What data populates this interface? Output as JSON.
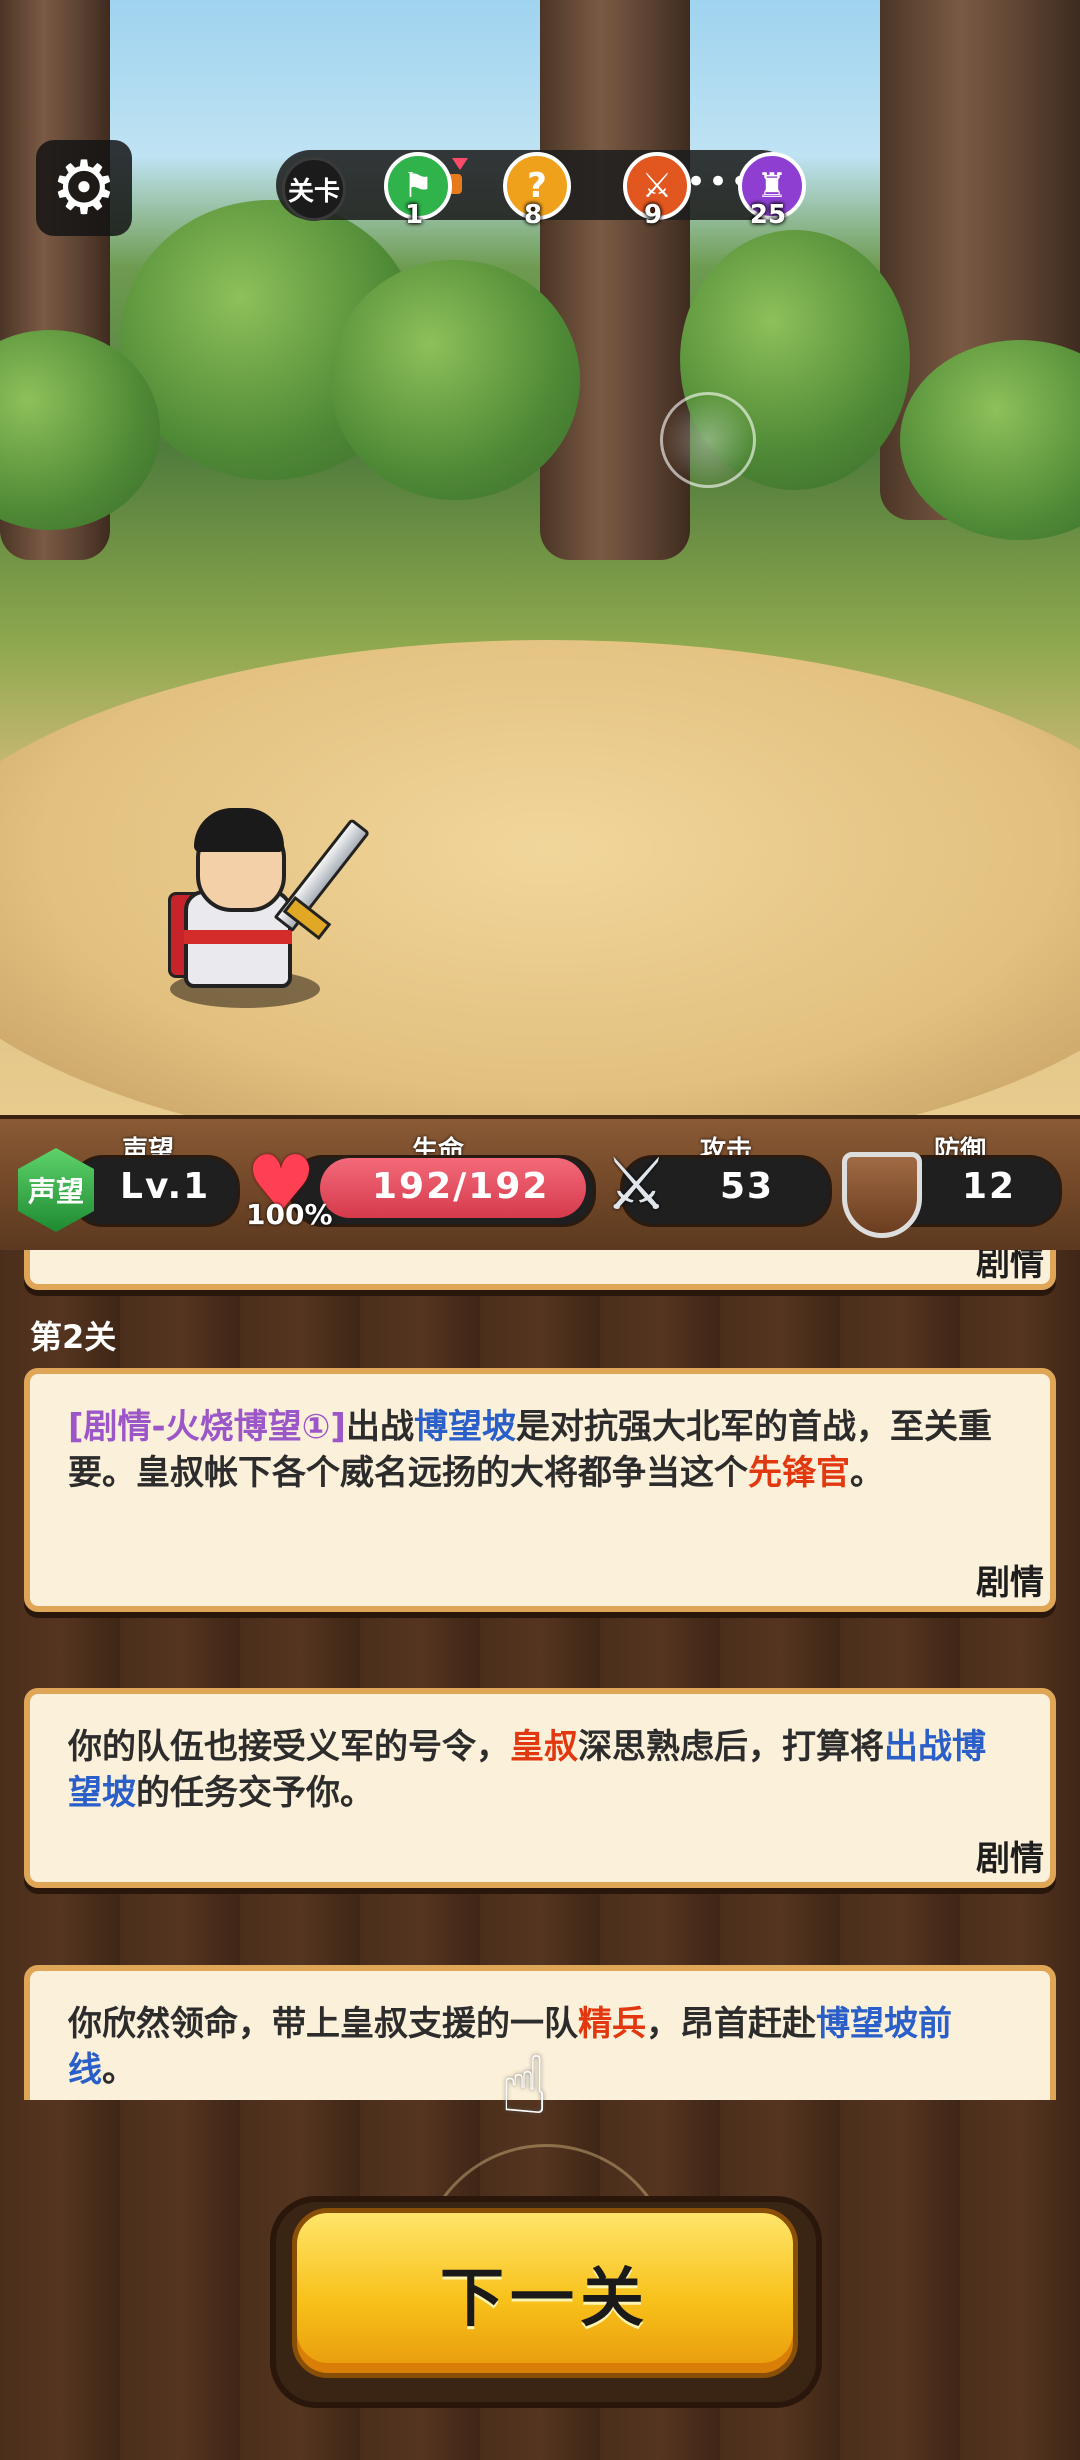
{
  "hud": {
    "settings_icon": "gear-icon",
    "level_label": "关卡",
    "level_nodes": [
      {
        "number": "1",
        "icon": "flag-icon",
        "color": "#2fb34a"
      },
      {
        "number": "8",
        "icon": "question-icon",
        "color": "#f0a11c"
      },
      {
        "number": "9",
        "icon": "crossed-swords-icon",
        "color": "#e2561f"
      },
      {
        "number": "25",
        "icon": "boss-helmet-icon",
        "color": "#8e3fd1"
      }
    ]
  },
  "stats": {
    "fame_label": "声望",
    "fame_badge": "声望",
    "fame_value": "Lv.1",
    "hp_label": "生命",
    "hp_value": "192/192",
    "hp_percent": "100%",
    "attack_label": "攻击",
    "attack_value": "53",
    "defense_label": "防御",
    "defense_value": "12"
  },
  "log": {
    "partial_tag": "剧情",
    "level_heading": "第2关",
    "cards": [
      {
        "segments": [
          {
            "text": "[剧情-火烧博望①]",
            "style": "purple"
          },
          {
            "text": "出战",
            "style": "normal"
          },
          {
            "text": "博望坡",
            "style": "blue"
          },
          {
            "text": "是对抗强大北军的首战，至关重要。皇叔帐下各个威名远扬的大将都争当这个",
            "style": "normal"
          },
          {
            "text": "先锋官",
            "style": "red"
          },
          {
            "text": "。",
            "style": "normal"
          }
        ],
        "tag": "剧情"
      },
      {
        "segments": [
          {
            "text": "你的队伍也接受义军的号令，",
            "style": "normal"
          },
          {
            "text": "皇叔",
            "style": "red"
          },
          {
            "text": "深思熟虑后，打算将",
            "style": "normal"
          },
          {
            "text": "出战博望坡",
            "style": "blue"
          },
          {
            "text": "的任务交予你。",
            "style": "normal"
          }
        ],
        "tag": "剧情"
      },
      {
        "segments": [
          {
            "text": "你欣然领命，带上皇叔支援的一队",
            "style": "normal"
          },
          {
            "text": "精兵",
            "style": "red"
          },
          {
            "text": "，昂首赶赴",
            "style": "normal"
          },
          {
            "text": "博望坡前线",
            "style": "blue"
          },
          {
            "text": "。",
            "style": "normal"
          }
        ]
      }
    ]
  },
  "next_button": {
    "label": "下一关"
  },
  "colors": {
    "accent_gold": "#f8c11a",
    "card_bg": "#fbf0d9",
    "hp_red": "#d53a4c"
  }
}
